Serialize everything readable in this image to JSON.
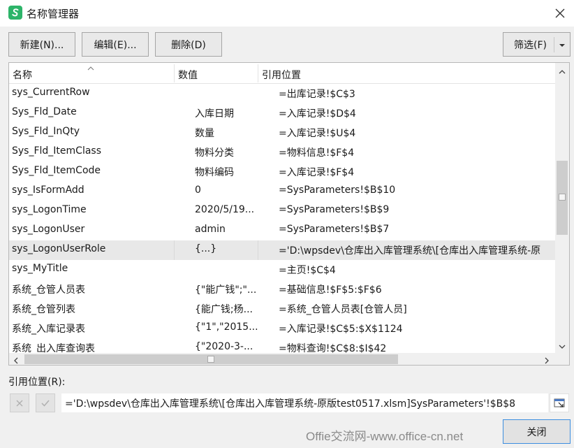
{
  "window": {
    "title": "名称管理器"
  },
  "toolbar": {
    "new_label": "新建(N)...",
    "edit_label": "编辑(E)...",
    "delete_label": "删除(D)",
    "filter_label": "筛选(F)"
  },
  "list": {
    "columns": {
      "name": "名称",
      "value": "数值",
      "ref": "引用位置"
    },
    "rows": [
      {
        "name": "sys_CurrentRow",
        "value": "",
        "ref": "=出库记录!$C$3"
      },
      {
        "name": "Sys_Fld_Date",
        "value": "入库日期",
        "ref": "=入库记录!$D$4"
      },
      {
        "name": "Sys_Fld_InQty",
        "value": "数量",
        "ref": "=入库记录!$U$4"
      },
      {
        "name": "Sys_Fld_ItemClass",
        "value": "物料分类",
        "ref": "=物料信息!$F$4"
      },
      {
        "name": "Sys_Fld_ItemCode",
        "value": "物料编码",
        "ref": "=入库记录!$F$4"
      },
      {
        "name": "sys_IsFormAdd",
        "value": "0",
        "ref": "=SysParameters!$B$10"
      },
      {
        "name": "sys_LogonTime",
        "value": "2020/5/19...",
        "ref": "=SysParameters!$B$9"
      },
      {
        "name": "sys_LogonUser",
        "value": "admin",
        "ref": "=SysParameters!$B$7"
      },
      {
        "name": "sys_LogonUserRole",
        "value": "{...}",
        "ref": "='D:\\wpsdev\\仓库出入库管理系统\\[仓库出入库管理系统-原"
      },
      {
        "name": "sys_MyTitle",
        "value": "",
        "ref": "=主页!$C$4"
      },
      {
        "name": "系统_仓管人员表",
        "value": "{\"能广钱\";\"...",
        "ref": "=基础信息!$F$5:$F$6"
      },
      {
        "name": "系统_仓管列表",
        "value": "{能广钱;杨...",
        "ref": "=系统_仓管人员表[仓管人员]"
      },
      {
        "name": "系统_入库记录表",
        "value": "{\"1\",\"2015...",
        "ref": "=入库记录!$C$5:$X$1124"
      },
      {
        "name": "系统_出入库查询表",
        "value": "{\"2020-3-...",
        "ref": "=物料查询!$C$8:$I$42"
      }
    ]
  },
  "ref_section": {
    "label": "引用位置(R):",
    "value": "='D:\\wpsdev\\仓库出入库管理系统\\[仓库出入库管理系统-原版test0517.xlsm]SysParameters'!$B$8"
  },
  "footer": {
    "watermark": "Offie交流网-www.office-cn.net",
    "close_label": "关闭"
  },
  "colors": {
    "app_icon": "#2db469",
    "selected_row": "#e8e8e8",
    "default_button_border": "#3c8ee0"
  }
}
